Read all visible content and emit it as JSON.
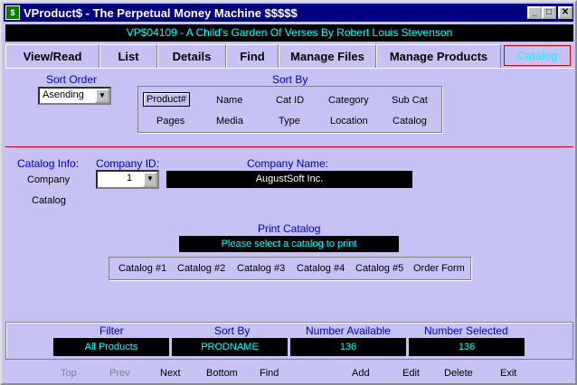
{
  "window": {
    "title": "VProduct$ - The Perpetual Money Machine $$$$$",
    "icon": "app-icon"
  },
  "banner": "VP$04109 - A Child's Garden Of Verses By Robert Louis Stevenson",
  "tabs": [
    "View/Read",
    "List",
    "Details",
    "Find",
    "Manage Files",
    "Manage Products",
    "Catalog"
  ],
  "sort_order": {
    "label": "Sort Order",
    "value": "Asending"
  },
  "sort_by": {
    "label": "Sort By",
    "row1": [
      "Product#",
      "Name",
      "Cat ID",
      "Category",
      "Sub Cat"
    ],
    "row2": [
      "Pages",
      "Media",
      "Type",
      "Location",
      "Catalog"
    ]
  },
  "catalog_info": {
    "label": "Catalog Info:",
    "company": "Company",
    "catalog": "Catalog",
    "company_id_label": "Company ID:",
    "company_id_value": "1",
    "company_name_label": "Company Name:",
    "company_name_value": "AugustSoft Inc."
  },
  "print_catalog": {
    "label": "Print Catalog",
    "message": "Please select a catalog to print",
    "options": [
      "Catalog #1",
      "Catalog #2",
      "Catalog #3",
      "Catalog #4",
      "Catalog #5",
      "Order Form"
    ]
  },
  "status": {
    "filter_label": "Filter",
    "filter_value": "All Products",
    "sortby_label": "Sort By",
    "sortby_value": "PRODNAME",
    "available_label": "Number Available",
    "available_value": "136",
    "selected_label": "Number Selected",
    "selected_value": "136"
  },
  "nav": {
    "top": "Top",
    "prev": "Prev",
    "next": "Next",
    "bottom": "Bottom",
    "find": "Find",
    "add": "Add",
    "edit": "Edit",
    "delete": "Delete",
    "exit": "Exit"
  },
  "colors": {
    "background": "#c6c3f4",
    "title_bar": "#000080",
    "accent_text": "#00ffff",
    "label_text": "#0000c0",
    "divider": "#c00000"
  }
}
